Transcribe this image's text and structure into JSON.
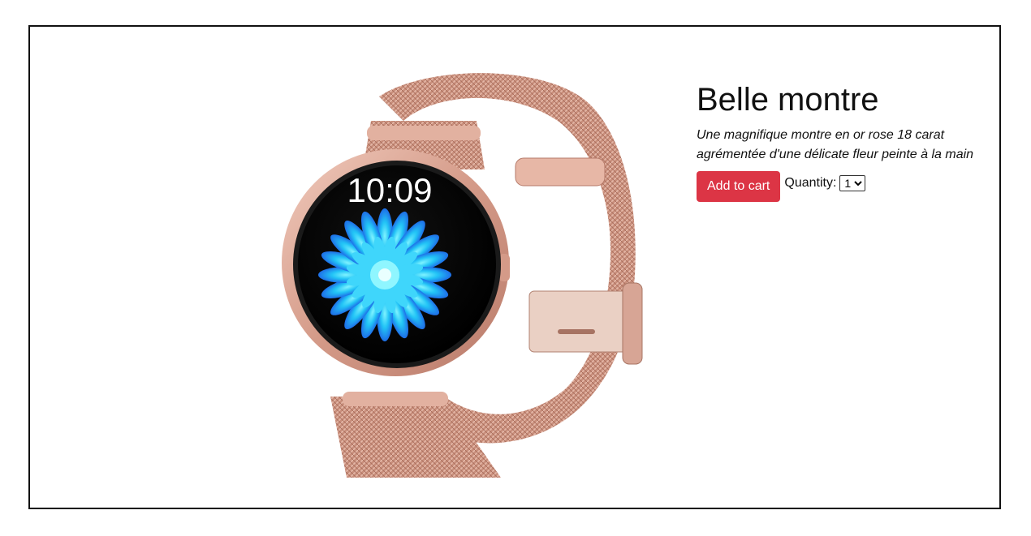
{
  "product": {
    "title": "Belle montre",
    "description_line1": "Une magnifique montre en or rose 18 carat",
    "description_line2": "agrémentée d'une délicate fleur peinte à la main",
    "add_to_cart_label": "Add to cart",
    "quantity_label": "Quantity:",
    "quantity_options": [
      "1"
    ],
    "quantity_selected": "1",
    "watch_time": "10:09",
    "accent_color": "#dc3545",
    "case_color": "#d7a595",
    "flower_color": "#1fb6f5"
  }
}
